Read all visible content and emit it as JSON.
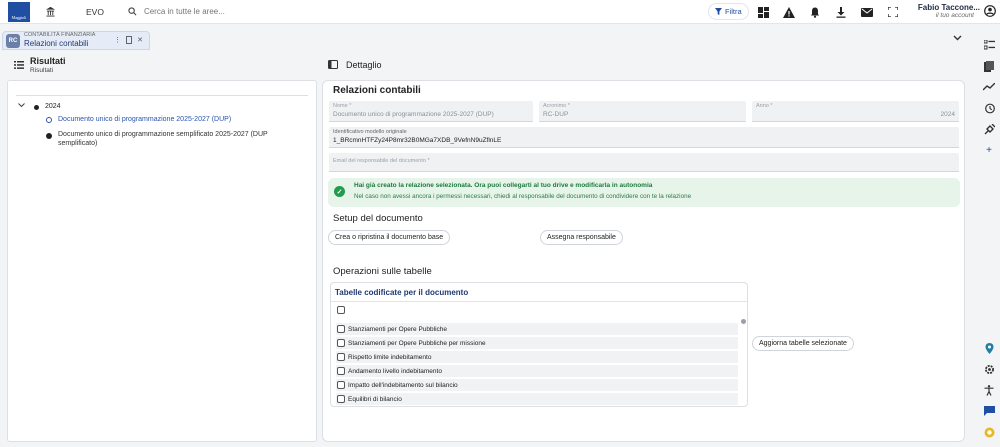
{
  "topbar": {
    "logo_text": "Maggioli",
    "app_name": "EVO",
    "search_placeholder": "Cerca in tutte le aree...",
    "filter_label": "Filtra",
    "user_name": "Fabio Taccone...",
    "user_role": "il tuo account",
    "icons": [
      "dashboard-icon",
      "warning-icon",
      "bell-icon",
      "download-icon",
      "mail-icon",
      "fullscreen-icon"
    ]
  },
  "tab": {
    "icon_text": "RC",
    "subtitle": "CONTABILITÀ FINANZIARIA",
    "title": "Relazioni contabili"
  },
  "left": {
    "title": "Risultati",
    "subtitle": "Risultati",
    "tree": {
      "year": "2024",
      "items": [
        "Documento unico di programmazione 2025-2027 (DUP)",
        "Documento unico di programmazione semplificato 2025-2027 (DUP semplificato)"
      ]
    }
  },
  "right": {
    "header": "Dettaglio",
    "title": "Relazioni contabili",
    "fields": {
      "name_label": "Nome *",
      "name_value": "Documento unico di programmazione 2025-2027 (DUP)",
      "acronym_label": "Acronimo *",
      "acronym_value": "RC-DUP",
      "year_label": "Anno *",
      "year_value": "2024",
      "model_label": "Identificativo modello originale",
      "model_value": "1_BRcmnHTFZy24P8mr32B0MGa7XDB_9VefnN9uZflnLE",
      "email_label": "Email del responsabile del documento *",
      "email_value": ""
    },
    "alert": {
      "title": "Hai già creato la relazione selezionata. Ora puoi collegarti al tuo drive e modificarla in autonomia",
      "text": "Nel caso non avessi ancora i permessi necessari, chiedi al responsabile del documento di condividere con te la relazione"
    },
    "setup": {
      "title": "Setup del documento",
      "create_button": "Crea o ripristina il documento base",
      "assign_button": "Assegna responsabile"
    },
    "operations": {
      "title": "Operazioni sulle tabelle",
      "card_title": "Tabelle codificate per il documento",
      "rows": [
        "Stanziamenti per Opere Pubbliche",
        "Stanziamenti per Opere Pubbliche per missione",
        "Rispetto limite indebitamento",
        "Andamento livello indebitamento",
        "Impatto dell'indebitamento sul bilancio",
        "Equilibri di bilancio"
      ],
      "update_button": "Aggiorna tabelle selezionate"
    }
  },
  "rail": {
    "icons_top": [
      "list-icon",
      "bookmark-icon",
      "trend-icon",
      "history-icon",
      "plugin-icon",
      "plus-icon"
    ],
    "icons_bottom": [
      "location-icon",
      "settings-icon",
      "accessibility-icon",
      "chat-icon",
      "support-icon"
    ]
  }
}
